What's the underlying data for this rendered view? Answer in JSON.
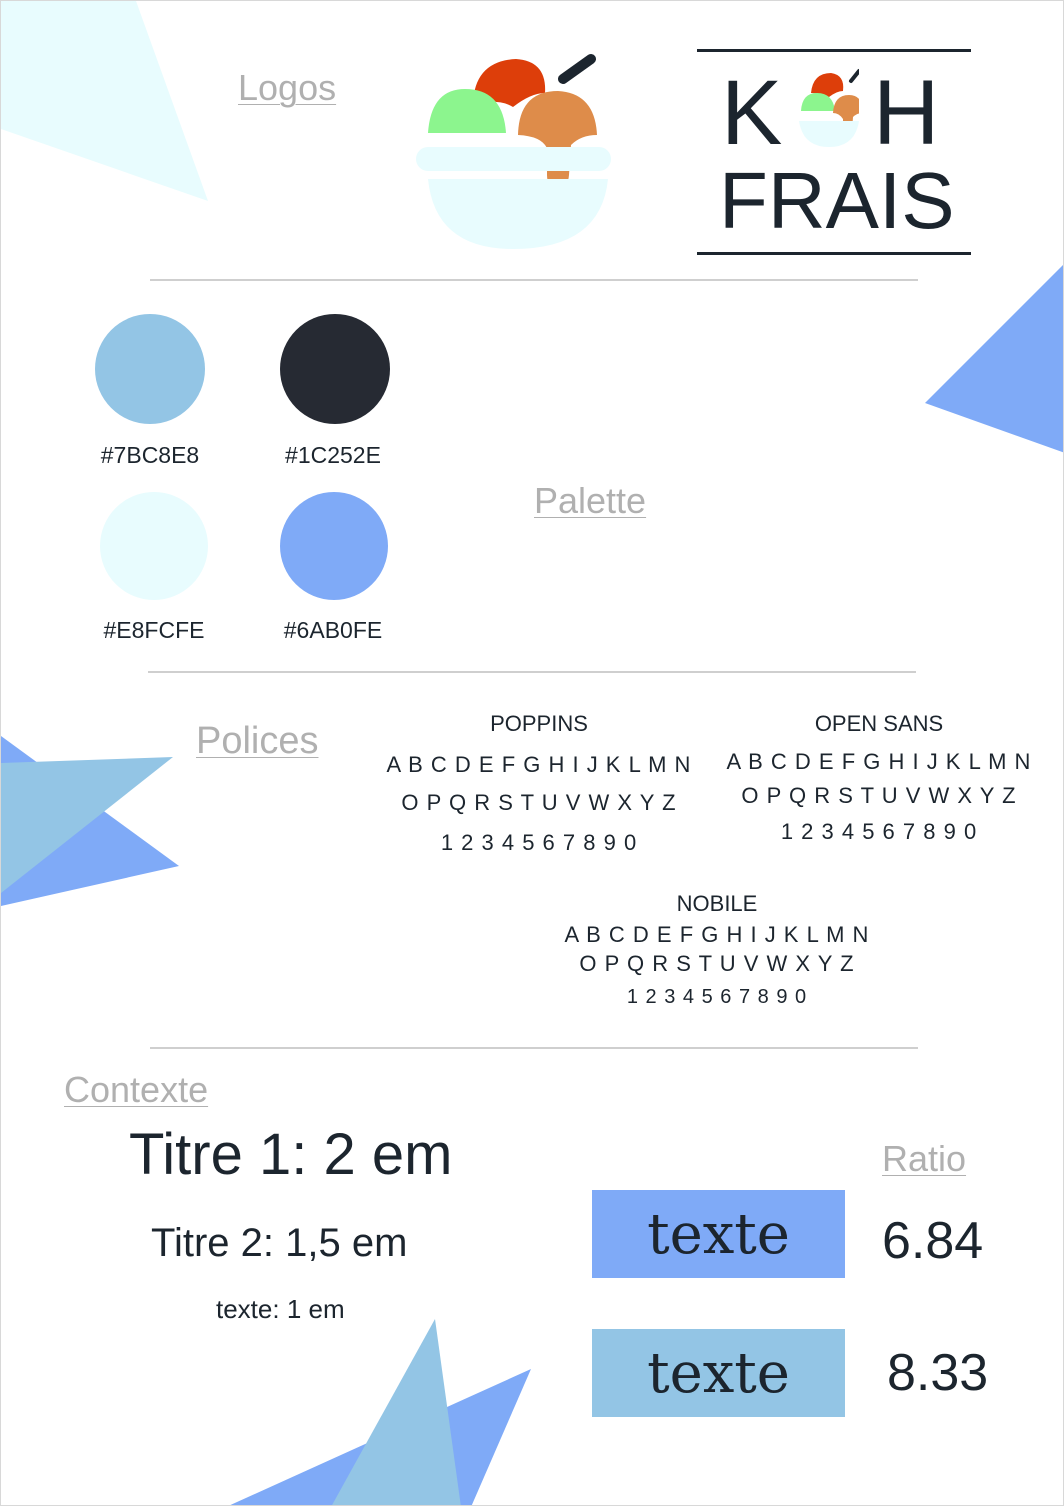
{
  "sections": {
    "logos": "Logos",
    "palette": "Palette",
    "polices": "Polices",
    "contexte": "Contexte",
    "ratio": "Ratio"
  },
  "brand": {
    "line1": "K",
    "line1b": "H",
    "line2": "FRAIS"
  },
  "colors": {
    "ice_red": "#DD3E0A",
    "ice_green": "#8CF58E",
    "ice_orange": "#DE8C4A"
  },
  "palette": [
    {
      "hex": "#7BC8E8",
      "label": "#7BC8E8"
    },
    {
      "hex": "#1C252E",
      "label": "#1C252E"
    },
    {
      "hex": "#E8FCFE",
      "label": "#E8FCFE"
    },
    {
      "hex": "#6AB0FE",
      "label": "#6AB0FE"
    }
  ],
  "fonts": [
    {
      "name": "POPPINS",
      "row1": "A B C D E F G H I J K L M N",
      "row2": "O P Q R S T U V W X Y Z",
      "row3": "1 2 3 4 5 6 7 8 9 0"
    },
    {
      "name": "OPEN SANS",
      "row1": "A B C D E F G H I J K L M N",
      "row2": "O P Q R S T U V W X Y Z",
      "row3": "1 2 3 4 5 6 7 8 9 0"
    },
    {
      "name": "NOBILE",
      "row1": "A B C D E F G H I J K L M N",
      "row2": "O P Q R S T U V W X Y Z",
      "row3": "1 2 3 4 5 6 7 8 9 0"
    }
  ],
  "context": {
    "titre1": "Titre 1: 2 em",
    "titre2": "Titre 2: 1,5 em",
    "texte": "texte: 1 em"
  },
  "ratios": [
    {
      "sample": "texte",
      "bg": "#7FAAF7",
      "value": "6.84"
    },
    {
      "sample": "texte",
      "bg": "#93C5E5",
      "value": "8.33"
    }
  ]
}
